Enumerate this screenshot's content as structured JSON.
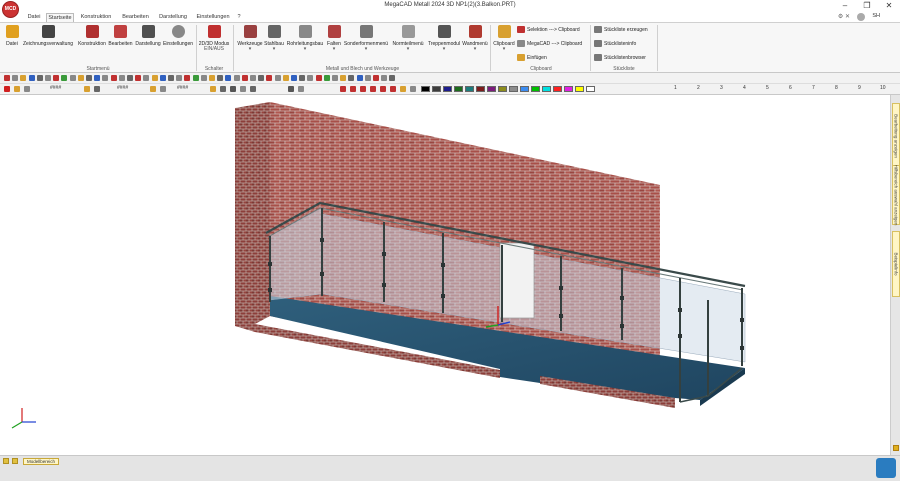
{
  "window": {
    "title": "MegaCAD Metall 2024 3D NP1(2)(3.Balkon.PRT)",
    "controls": [
      "–",
      "❐",
      "✕"
    ]
  },
  "app_icon": {
    "label": "MCD"
  },
  "tabs": [
    "Datei",
    "Startseite",
    "Konstruktion",
    "Bearbeiten",
    "Darstellung",
    "Einstellungen",
    "?"
  ],
  "active_tab": "Startseite",
  "user_label": "SH",
  "ribbon": {
    "startmenu": {
      "buttons": [
        "Datei",
        "Zeichnungsverwaltung",
        "Konstruktion",
        "Bearbeiten",
        "Darstellung",
        "Einstellungen"
      ],
      "label": "Startmenü"
    },
    "schalter": {
      "button": "2D/3D Modus",
      "sub": "EIN/AUS",
      "label": "Schalter"
    },
    "metall": {
      "buttons": [
        "Werkzeuge",
        "Stahlbau",
        "Rohrleitungsbau",
        "Falten",
        "Sonderformenmenü",
        "Normteilmenü",
        "Treppenmodul",
        "Wandmenü"
      ],
      "label": "Metall und Blech und Werkzeuge"
    },
    "clipboard": {
      "button": "Clipboard",
      "items": [
        "Selektion ---> Clipboard",
        "MegaCAD ---> Clipboard",
        "Einfügen"
      ],
      "label": "Clipboard"
    },
    "stueckliste": {
      "items": [
        "Stückliste erzeugen",
        "Stücklisteninfo",
        "Stücklistenbrowser"
      ],
      "label": "Stückliste"
    }
  },
  "toolbar": {
    "hatch_a": "####",
    "hatch_b": "####",
    "hatch_c": "####",
    "numbers": [
      "1",
      "2",
      "3",
      "4",
      "5",
      "6",
      "7",
      "8",
      "9",
      "10"
    ]
  },
  "palette": [
    "#000000",
    "#3c3c3c",
    "#1c1c8c",
    "#1c6c1c",
    "#1c7c7c",
    "#7c1c1c",
    "#7c1c7c",
    "#8c8c1c",
    "#8c8c8c",
    "#3c8cf0",
    "#00c000",
    "#00e0e0",
    "#ff2020",
    "#e020e0",
    "#ffff00",
    "#ffffff"
  ],
  "side_tabs": [
    "Bearbeitung anzeigen",
    "Hilfsbereich auswahl anzeigen",
    "Beispielinfo"
  ],
  "statusbar": {
    "model_tab": "Modellbereich"
  },
  "colors": {
    "brick": "#9c4a45",
    "mortar": "#d8cfca",
    "floor": "#2e5d7a",
    "glass": "#c9d8e6",
    "rail": "#3a4a4a"
  }
}
